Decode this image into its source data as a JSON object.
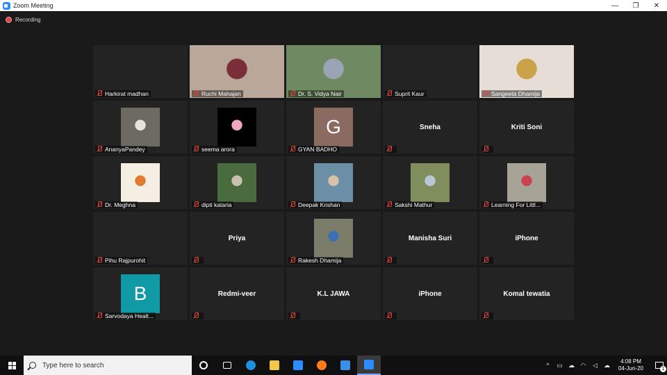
{
  "window": {
    "title": "Zoom Meeting",
    "minimize": "—",
    "restore": "❐",
    "close": "✕"
  },
  "recording": {
    "label": "Recording"
  },
  "participants": [
    {
      "name": "Harkirat madhan",
      "kind": "blank"
    },
    {
      "name": "Ruchi Mahajan",
      "kind": "video",
      "bg": "#b9a79a",
      "fg": "#7a2e3a"
    },
    {
      "name": "Dr. S. Vidya Nair",
      "kind": "video",
      "bg": "#6f8a62",
      "fg": "#9aa4b4",
      "active": true
    },
    {
      "name": "Suprit Kaur",
      "kind": "blank"
    },
    {
      "name": "Sangeeta Dhamija",
      "kind": "video",
      "bg": "#e6ddd6",
      "fg": "#c9a24a"
    },
    {
      "name": "AnanyaPandey",
      "kind": "photo",
      "bg": "#6d6a62",
      "fg": "#e7e4dc"
    },
    {
      "name": "seema arora",
      "kind": "photo",
      "bg": "#000000",
      "fg": "#f0a7c0"
    },
    {
      "name": "GYAN BADHO",
      "kind": "avatar",
      "letter": "G",
      "color": "#8b6b61"
    },
    {
      "name": "Sneha",
      "kind": "name-only"
    },
    {
      "name": "Kriti Soni",
      "kind": "name-only"
    },
    {
      "name": "Dr. Meghna",
      "kind": "photo",
      "bg": "#f4efe2",
      "fg": "#e07b2f"
    },
    {
      "name": "dipti kataria",
      "kind": "photo",
      "bg": "#4a6b3e",
      "fg": "#c9c0b2"
    },
    {
      "name": "Deepak Krishan",
      "kind": "photo",
      "bg": "#6a8fa6",
      "fg": "#d7c1a8"
    },
    {
      "name": "Sakshi Mathur",
      "kind": "photo",
      "bg": "#7f8e5c",
      "fg": "#b7c7d6"
    },
    {
      "name": "Learning For Littl...",
      "kind": "photo",
      "bg": "#a8a397",
      "fg": "#c9424f"
    },
    {
      "name": "Pihu Rajpurohit",
      "kind": "blank"
    },
    {
      "name": "Priya",
      "kind": "name-only"
    },
    {
      "name": "Rakesh Dhamija",
      "kind": "photo",
      "bg": "#7b7c6a",
      "fg": "#3f6fb3"
    },
    {
      "name": "Manisha Suri",
      "kind": "name-only"
    },
    {
      "name": "iPhone",
      "kind": "name-only"
    },
    {
      "name": "Sarvodaya Healt...",
      "kind": "avatar",
      "letter": "B",
      "color": "#0f9aa6"
    },
    {
      "name": "Redmi-veer",
      "kind": "name-only"
    },
    {
      "name": "K.L JAWA",
      "kind": "name-only"
    },
    {
      "name": "iPhone",
      "kind": "name-only"
    },
    {
      "name": "Komal tewatia",
      "kind": "name-only"
    }
  ],
  "taskbar": {
    "search_placeholder": "Type here to search",
    "apps": [
      {
        "icon": "cortana-icon",
        "color": "#ffffff"
      },
      {
        "icon": "task-view-icon",
        "color": "#ffffff"
      },
      {
        "icon": "edge-icon",
        "color": "#1f8fe0"
      },
      {
        "icon": "file-explorer-icon",
        "color": "#f2c84a"
      },
      {
        "icon": "store-icon",
        "color": "#2d8cff"
      },
      {
        "icon": "firefox-icon",
        "color": "#ff7a1a"
      },
      {
        "icon": "mail-icon",
        "color": "#3b8ee6"
      },
      {
        "icon": "zoom-icon",
        "color": "#2d8cff",
        "active": true
      }
    ],
    "time": "4:08 PM",
    "date": "04-Jun-20",
    "notification_count": "1"
  }
}
